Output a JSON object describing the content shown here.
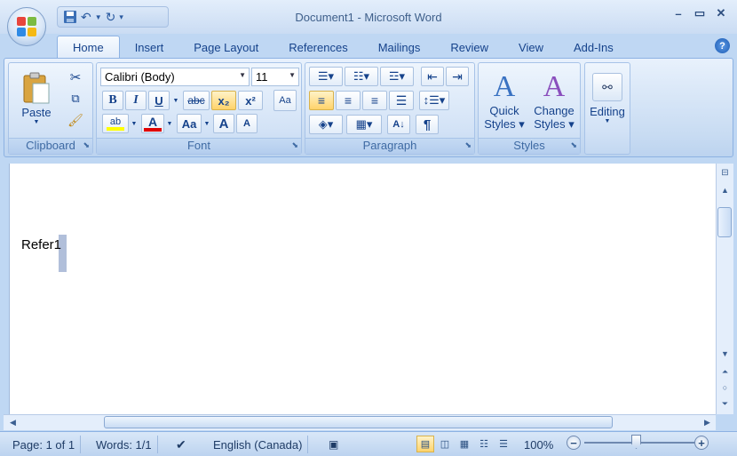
{
  "window": {
    "title": "Document1 - Microsoft Word"
  },
  "quick_access": {
    "items": [
      "save-icon",
      "undo-icon",
      "redo-icon",
      "customize-arrow-icon"
    ]
  },
  "ribbon": {
    "tabs": [
      {
        "label": "Home",
        "active": true
      },
      {
        "label": "Insert"
      },
      {
        "label": "Page Layout"
      },
      {
        "label": "References"
      },
      {
        "label": "Mailings"
      },
      {
        "label": "Review"
      },
      {
        "label": "View"
      },
      {
        "label": "Add-Ins"
      }
    ],
    "clipboard": {
      "label": "Clipboard",
      "paste_label": "Paste"
    },
    "font": {
      "label": "Font",
      "font_name": "Calibri (Body)",
      "font_size": "11",
      "bold_label": "B",
      "italic_label": "I",
      "underline_label": "U",
      "strike_label": "abc",
      "subscript_label": "x₂",
      "superscript_label": "x²",
      "highlight_label": "ab",
      "font_color_label": "A",
      "change_case_label": "Aa",
      "grow_label": "A",
      "shrink_label": "A"
    },
    "paragraph": {
      "label": "Paragraph",
      "pilcrow": "¶"
    },
    "styles": {
      "label": "Styles",
      "quick_styles_line1": "Quick",
      "quick_styles_line2": "Styles",
      "change_styles_line1": "Change",
      "change_styles_line2": "Styles"
    },
    "editing": {
      "label": "Editing"
    }
  },
  "document": {
    "text": "Refer1"
  },
  "status": {
    "page": "Page: 1 of 1",
    "words": "Words: 1/1",
    "language": "English (Canada)",
    "zoom": "100%",
    "zoom_level_percent": 100
  },
  "colors": {
    "ribbon_blue": "#c7dbf2",
    "active_highlight": "#ffd36b",
    "highlight_yellow": "#ffff00",
    "font_color_red": "#e00000"
  }
}
